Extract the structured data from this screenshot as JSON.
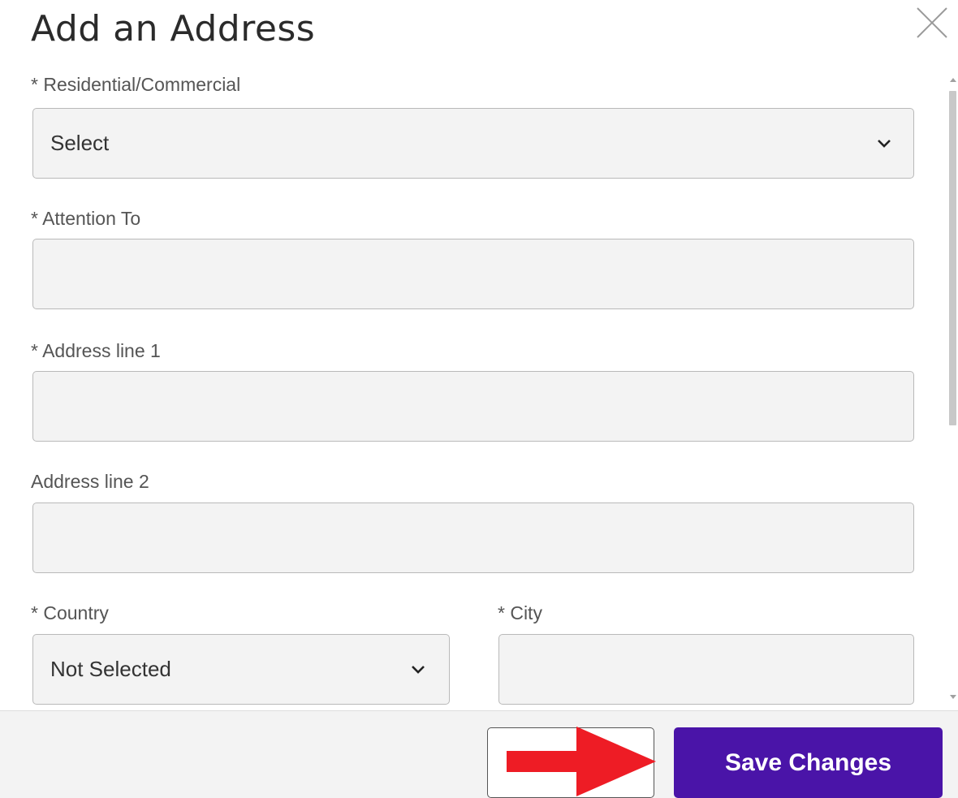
{
  "dialog": {
    "title": "Add an Address"
  },
  "form": {
    "residential_commercial": {
      "label": "* Residential/Commercial",
      "value": "Select"
    },
    "attention_to": {
      "label": "* Attention To",
      "value": ""
    },
    "address_line_1": {
      "label": "* Address line 1",
      "value": ""
    },
    "address_line_2": {
      "label": "Address line 2",
      "value": ""
    },
    "country": {
      "label": "* Country",
      "value": "Not Selected"
    },
    "city": {
      "label": "* City",
      "value": ""
    }
  },
  "footer": {
    "cancel_label": "",
    "save_label": "Save Changes"
  },
  "colors": {
    "primary_button": "#4a14a8",
    "annotation_arrow": "#ee1c25",
    "field_background": "#f3f3f3"
  },
  "icons": [
    "close-icon",
    "chevron-down-icon",
    "annotation-arrow-icon"
  ]
}
